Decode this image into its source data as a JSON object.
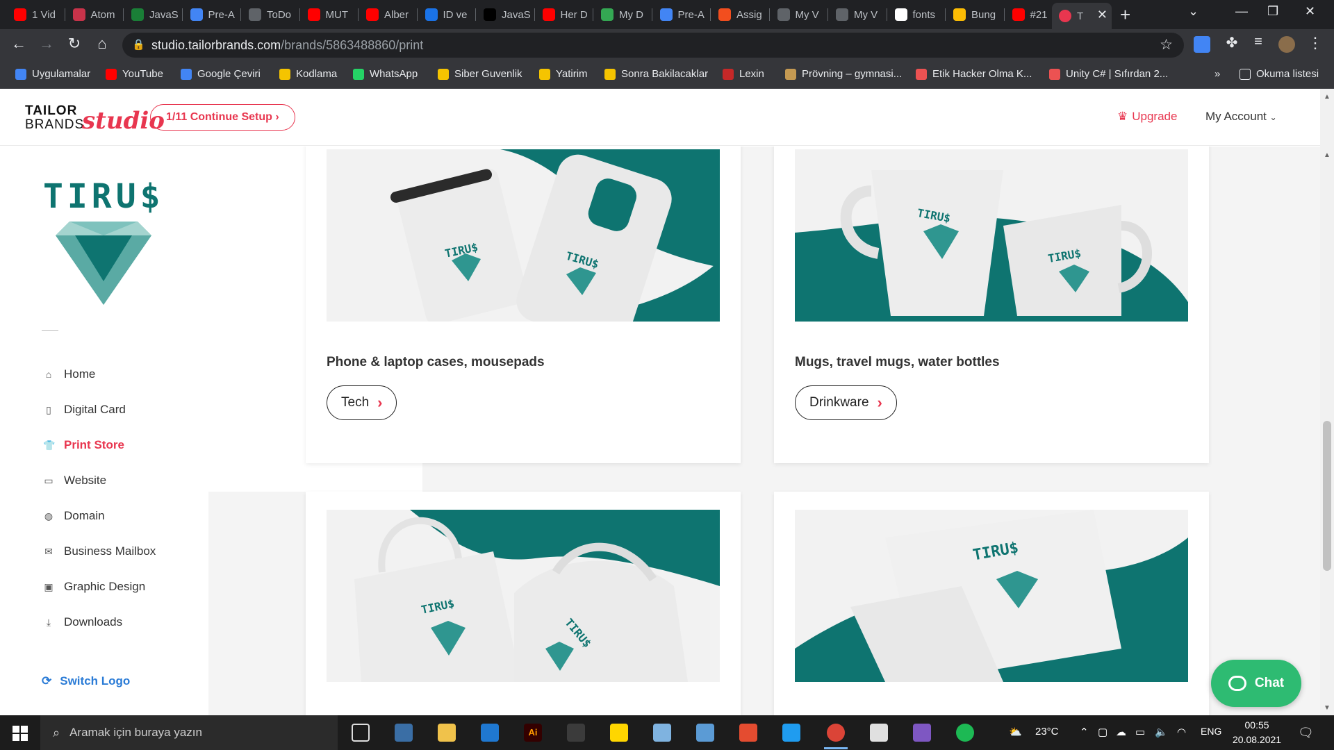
{
  "browser": {
    "tabs": [
      {
        "label": "1 Vid",
        "icon": "youtube-icon",
        "color": "#ff0000"
      },
      {
        "label": "Atom",
        "icon": "atom-icon",
        "color": "#c8334a"
      },
      {
        "label": "JavaS",
        "icon": "w-icon",
        "color": "#1a7f37"
      },
      {
        "label": "Pre-A",
        "icon": "docs-icon",
        "color": "#4285f4"
      },
      {
        "label": "ToDo",
        "icon": "globe-icon",
        "color": "#5f6368"
      },
      {
        "label": "MUT",
        "icon": "youtube-icon",
        "color": "#ff0000"
      },
      {
        "label": "Alber",
        "icon": "youtube-icon",
        "color": "#ff0000"
      },
      {
        "label": "ID ve",
        "icon": "id-icon",
        "color": "#1a73e8"
      },
      {
        "label": "JavaS",
        "icon": "medium-icon",
        "color": "#000000"
      },
      {
        "label": "Her D",
        "icon": "youtube-icon",
        "color": "#ff0000"
      },
      {
        "label": "My D",
        "icon": "drive-icon",
        "color": "#34a853"
      },
      {
        "label": "Pre-A",
        "icon": "docs-icon",
        "color": "#4285f4"
      },
      {
        "label": "Assig",
        "icon": "figma-icon",
        "color": "#f24e1e"
      },
      {
        "label": "My V",
        "icon": "globe-icon",
        "color": "#5f6368"
      },
      {
        "label": "My V",
        "icon": "globe-icon",
        "color": "#5f6368"
      },
      {
        "label": "fonts",
        "icon": "google-icon",
        "color": "#ffffff"
      },
      {
        "label": "Bung",
        "icon": "bungee-icon",
        "color": "#fbbc04"
      },
      {
        "label": "#21",
        "icon": "youtube-icon",
        "color": "#ff0000"
      }
    ],
    "active_tab": {
      "label": "T",
      "icon": "tailor-brands-icon",
      "color": "#e8364f"
    },
    "url_host": "studio.tailorbrands.com",
    "url_path": "/brands/5863488860/print",
    "bookmarks": [
      {
        "label": "Uygulamalar",
        "color": "#4285f4"
      },
      {
        "label": "YouTube",
        "color": "#ff0000"
      },
      {
        "label": "Google Çeviri",
        "color": "#4285f4"
      },
      {
        "label": "Kodlama",
        "color": "#f5c400"
      },
      {
        "label": "WhatsApp",
        "color": "#25d366"
      },
      {
        "label": "Siber Guvenlik",
        "color": "#f5c400"
      },
      {
        "label": "Yatirim",
        "color": "#f5c400"
      },
      {
        "label": "Sonra Bakilacaklar",
        "color": "#f5c400"
      },
      {
        "label": "Lexin",
        "color": "#c62828"
      },
      {
        "label": "Prövning – gymnasi...",
        "color": "#c59a52"
      },
      {
        "label": "Etik Hacker Olma K...",
        "color": "#ec5252"
      },
      {
        "label": "Unity C# | Sıfırdan 2...",
        "color": "#ec5252"
      }
    ],
    "bookmarks_more": "»",
    "reading_list": "Okuma listesi"
  },
  "header": {
    "logo_line1": "TAILOR",
    "logo_line2": "BRANDS",
    "logo_studio": "studio",
    "setup_label": "1/11 Continue Setup",
    "upgrade_label": "Upgrade",
    "account_label": "My Account"
  },
  "sidebar": {
    "brand_name": "TIRU$",
    "items": [
      {
        "label": "Home",
        "icon": "home-icon",
        "glyph": "⌂"
      },
      {
        "label": "Digital Card",
        "icon": "phone-card-icon",
        "glyph": "▯"
      },
      {
        "label": "Print Store",
        "icon": "shirt-icon",
        "glyph": "👕",
        "active": true
      },
      {
        "label": "Website",
        "icon": "monitor-icon",
        "glyph": "▭"
      },
      {
        "label": "Domain",
        "icon": "globe-icon",
        "glyph": "◍"
      },
      {
        "label": "Business Mailbox",
        "icon": "mail-icon",
        "glyph": "✉"
      },
      {
        "label": "Graphic Design",
        "icon": "image-icon",
        "glyph": "▣"
      },
      {
        "label": "Downloads",
        "icon": "download-icon",
        "glyph": "⤓"
      }
    ],
    "switch_logo": "Switch Logo"
  },
  "main": {
    "cards": [
      {
        "title": "Phone & laptop cases, mousepads",
        "button": "Tech",
        "image": "tech-mockup"
      },
      {
        "title": "Mugs, travel mugs, water bottles",
        "button": "Drinkware",
        "image": "mugs-mockup"
      },
      {
        "title": "",
        "button": "",
        "image": "tote-mockup"
      },
      {
        "title": "",
        "button": "",
        "image": "stationery-mockup"
      }
    ],
    "mockup_brand": "TIRU$"
  },
  "chat": {
    "label": "Chat"
  },
  "taskbar": {
    "search_placeholder": "Aramak için buraya yazın",
    "temperature": "23°C",
    "language": "ENG",
    "time": "00:55",
    "date": "20.08.2021"
  },
  "colors": {
    "accent": "#e8364f",
    "brand_teal": "#0e7470",
    "chat_green": "#2ebb72",
    "link_blue": "#2a7bd6"
  }
}
